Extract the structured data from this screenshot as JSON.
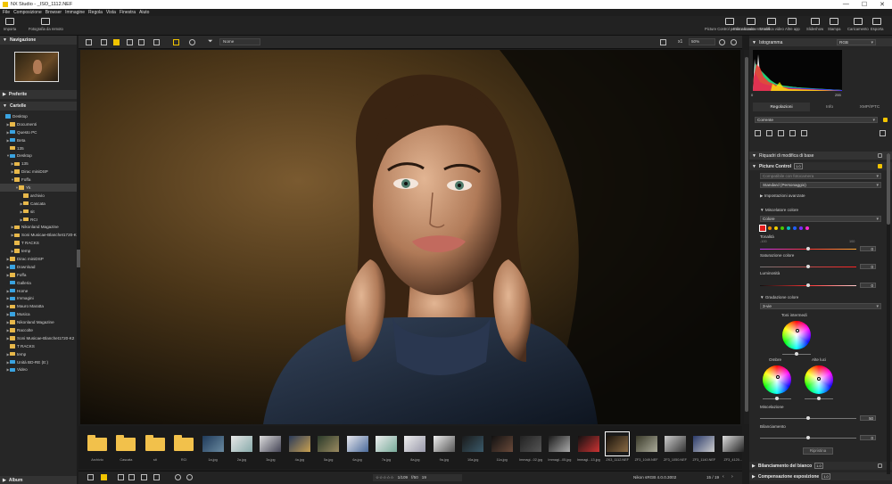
{
  "titlebar": {
    "title": "NX Studio - _ISO_1112.NEF",
    "minimize": "—",
    "maximize": "☐",
    "close": "✕"
  },
  "menu": [
    "File",
    "Composizione",
    "Browser",
    "Immagine",
    "Regola",
    "Vista",
    "Finestra",
    "Aiuto"
  ],
  "toolbar": {
    "left": [
      {
        "label": "Importa",
        "icon": "import-icon"
      },
      {
        "label": "Fotografia da remoto",
        "icon": "camera-remote-icon"
      }
    ],
    "right": [
      {
        "label": "Picture Control personalizzato",
        "icon": "picture-control-icon"
      },
      {
        "label": "Editor movimento reel",
        "icon": "reel-editor-icon"
      },
      {
        "label": "Modifica video",
        "icon": "video-edit-icon"
      },
      {
        "label": "Altre app",
        "icon": "apps-icon"
      },
      {
        "label": "Slideshow",
        "icon": "slideshow-icon"
      },
      {
        "label": "Stampa",
        "icon": "print-icon"
      },
      {
        "label": "Caricamento",
        "icon": "upload-icon"
      },
      {
        "label": "Esporta",
        "icon": "export-icon"
      }
    ]
  },
  "left": {
    "navigation": "Navigazione",
    "favorites": "Preferite",
    "folders": "Cartelle",
    "album": "Album",
    "tree": [
      {
        "label": "Desktop",
        "lvl": 0,
        "arrow": "",
        "blue": true
      },
      {
        "label": "Documenti",
        "lvl": 1,
        "arrow": "▶"
      },
      {
        "label": "Questo PC",
        "lvl": 1,
        "arrow": "▶",
        "blue": true
      },
      {
        "label": "Beta",
        "lvl": 1,
        "arrow": "▶",
        "blue": true
      },
      {
        "label": "135",
        "lvl": 1,
        "arrow": ""
      },
      {
        "label": "Desktop",
        "lvl": 1,
        "arrow": "▼",
        "blue": true
      },
      {
        "label": "135",
        "lvl": 2,
        "arrow": "▶"
      },
      {
        "label": "Dirac miniDSP",
        "lvl": 2,
        "arrow": "▶"
      },
      {
        "label": "Foffa",
        "lvl": 2,
        "arrow": "▼"
      },
      {
        "label": "Yk",
        "lvl": 3,
        "arrow": "▼",
        "sel": true
      },
      {
        "label": "archivio",
        "lvl": 4,
        "arrow": ""
      },
      {
        "label": "Cascata",
        "lvl": 4,
        "arrow": "▶"
      },
      {
        "label": "sit",
        "lvl": 4,
        "arrow": "▶"
      },
      {
        "label": "RCI",
        "lvl": 4,
        "arrow": "▶"
      },
      {
        "label": "Nikonland Magazine",
        "lvl": 2,
        "arrow": "▶"
      },
      {
        "label": "Soni Musicae-Blanchet1720-K",
        "lvl": 2,
        "arrow": "▶"
      },
      {
        "label": "T RACKS",
        "lvl": 2,
        "arrow": ""
      },
      {
        "label": "temp",
        "lvl": 2,
        "arrow": "▶"
      },
      {
        "label": "Dirac miniDSP",
        "lvl": 1,
        "arrow": "▶"
      },
      {
        "label": "Download",
        "lvl": 1,
        "arrow": "▶",
        "blue": true
      },
      {
        "label": "Foffa",
        "lvl": 1,
        "arrow": "▶"
      },
      {
        "label": "Galleria",
        "lvl": 1,
        "arrow": "",
        "blue": true
      },
      {
        "label": "Home",
        "lvl": 1,
        "arrow": "▶",
        "blue": true
      },
      {
        "label": "Immagini",
        "lvl": 1,
        "arrow": "▶",
        "blue": true
      },
      {
        "label": "Mauro Maratta",
        "lvl": 1,
        "arrow": "▶"
      },
      {
        "label": "Musica",
        "lvl": 1,
        "arrow": "▶",
        "blue": true
      },
      {
        "label": "Nikonland Magazine",
        "lvl": 1,
        "arrow": "▶"
      },
      {
        "label": "Raccolte",
        "lvl": 1,
        "arrow": "▶"
      },
      {
        "label": "Soni Musicae-Blanchet1720-K2",
        "lvl": 1,
        "arrow": "▶"
      },
      {
        "label": "T RACKS",
        "lvl": 1,
        "arrow": ""
      },
      {
        "label": "temp",
        "lvl": 1,
        "arrow": "▶"
      },
      {
        "label": "Unità BD-RE (E:)",
        "lvl": 1,
        "arrow": "▶",
        "blue": true
      },
      {
        "label": "Video",
        "lvl": 1,
        "arrow": "▶",
        "blue": true
      }
    ]
  },
  "viewer": {
    "sort": "Nome",
    "zoom_fit": "x1",
    "zoom": "50%"
  },
  "filmstrip": [
    {
      "label": "Archivio",
      "kind": "folder"
    },
    {
      "label": "Cascata",
      "kind": "folder"
    },
    {
      "label": "sit",
      "kind": "folder"
    },
    {
      "label": "RCI",
      "kind": "folder"
    },
    {
      "label": "1a.jpg",
      "kind": "img",
      "c1": "#1f3a5a",
      "c2": "#6a8aa0"
    },
    {
      "label": "2a.jpg",
      "kind": "img",
      "c1": "#e8e8e8",
      "c2": "#8aa"
    },
    {
      "label": "3a.jpg",
      "kind": "img",
      "c1": "#ddd",
      "c2": "#445"
    },
    {
      "label": "4a.jpg",
      "kind": "img",
      "c1": "#2a3a5a",
      "c2": "#c8a050"
    },
    {
      "label": "5a.jpg",
      "kind": "img",
      "c1": "#2a3a2a",
      "c2": "#9a8a60"
    },
    {
      "label": "6a.jpg",
      "kind": "img",
      "c1": "#e8e8ee",
      "c2": "#4a6a9a"
    },
    {
      "label": "7a.jpg",
      "kind": "img",
      "c1": "#eee",
      "c2": "#7a9"
    },
    {
      "label": "8a.jpg",
      "kind": "img",
      "c1": "#eee",
      "c2": "#99a"
    },
    {
      "label": "9a.jpg",
      "kind": "img",
      "c1": "#eee",
      "c2": "#555"
    },
    {
      "label": "10a.jpg",
      "kind": "img",
      "c1": "#1a1a1a",
      "c2": "#3a5a6a"
    },
    {
      "label": "11a.jpg",
      "kind": "img",
      "c1": "#111",
      "c2": "#6a4a3a"
    },
    {
      "label": "Immagi...02.jpg",
      "kind": "img",
      "c1": "#222",
      "c2": "#555"
    },
    {
      "label": "Immagi...05.jpg",
      "kind": "img",
      "c1": "#1a1a1a",
      "c2": "#aaa"
    },
    {
      "label": "Immagi...13.jpg",
      "kind": "img",
      "c1": "#111",
      "c2": "#c33"
    },
    {
      "label": "ZK3_1112.NEF",
      "kind": "img",
      "c1": "#1a140c",
      "c2": "#8a6a44",
      "sel": true
    },
    {
      "label": "ZF3_1049.NEF",
      "kind": "img",
      "c1": "#3a3a2a",
      "c2": "#aa9"
    },
    {
      "label": "ZF3_1050.NEF",
      "kind": "img",
      "c1": "#ccc",
      "c2": "#333"
    },
    {
      "label": "ZF3_1140.NEF",
      "kind": "img",
      "c1": "#2a3a6a",
      "c2": "#ccc"
    },
    {
      "label": "ZF3_4120...",
      "kind": "img",
      "c1": "#ddd",
      "c2": "#222"
    }
  ],
  "status": {
    "rating": "☆☆☆☆☆",
    "shutter": "1/109",
    "aperture": "f/50",
    "iso": "19",
    "profile": "Nikon sRGB 4.0.0.3002",
    "page": "15 / 19"
  },
  "right": {
    "histogram": "Istogramma",
    "hist_channel": "RGB",
    "hist_min": "0",
    "hist_max": "255",
    "tabs": [
      "Regolazioni",
      "Info",
      "XMP/IPTC"
    ],
    "preset": "Corrente",
    "base_edit": "Riquadri di modifica di base",
    "pc_title": "Picture Control",
    "pc_tag": "1.0",
    "pc_dropdown1": "Compatibile con fotocamera",
    "pc_dropdown2": "Standard (Personaggio)",
    "advanced": "Impostazioni avanzate",
    "mixer": "Miscelatore colore",
    "mixer_mode": "Colore",
    "swatches": [
      "#e21b1b",
      "#f08a00",
      "#f2d000",
      "#4bc900",
      "#00c0c0",
      "#1f5fff",
      "#7a2dff",
      "#ff2bd0"
    ],
    "hue": "Tonalità",
    "saturation": "Saturazione colore",
    "luminance": "Luminosità",
    "hue_min": "-100",
    "hue_max": "100",
    "hue_val": "0",
    "sat_val": "0",
    "lum_val": "0",
    "grading": "Gradazione colore",
    "grading_mode": "3-vie",
    "midtones": "Toni intermedi",
    "shadows": "Ombre",
    "highlights": "Alte luci",
    "blend": "Miscelazione",
    "blend_val": "50",
    "balance": "Bilanciamento",
    "balance_val": "0",
    "reset": "Ripristina",
    "wb": "Bilanciamento del bianco",
    "wb_tag": "1.0",
    "exp": "Compensazione esposizione",
    "exp_tag": "1.0",
    "accent": "#f2c400"
  }
}
